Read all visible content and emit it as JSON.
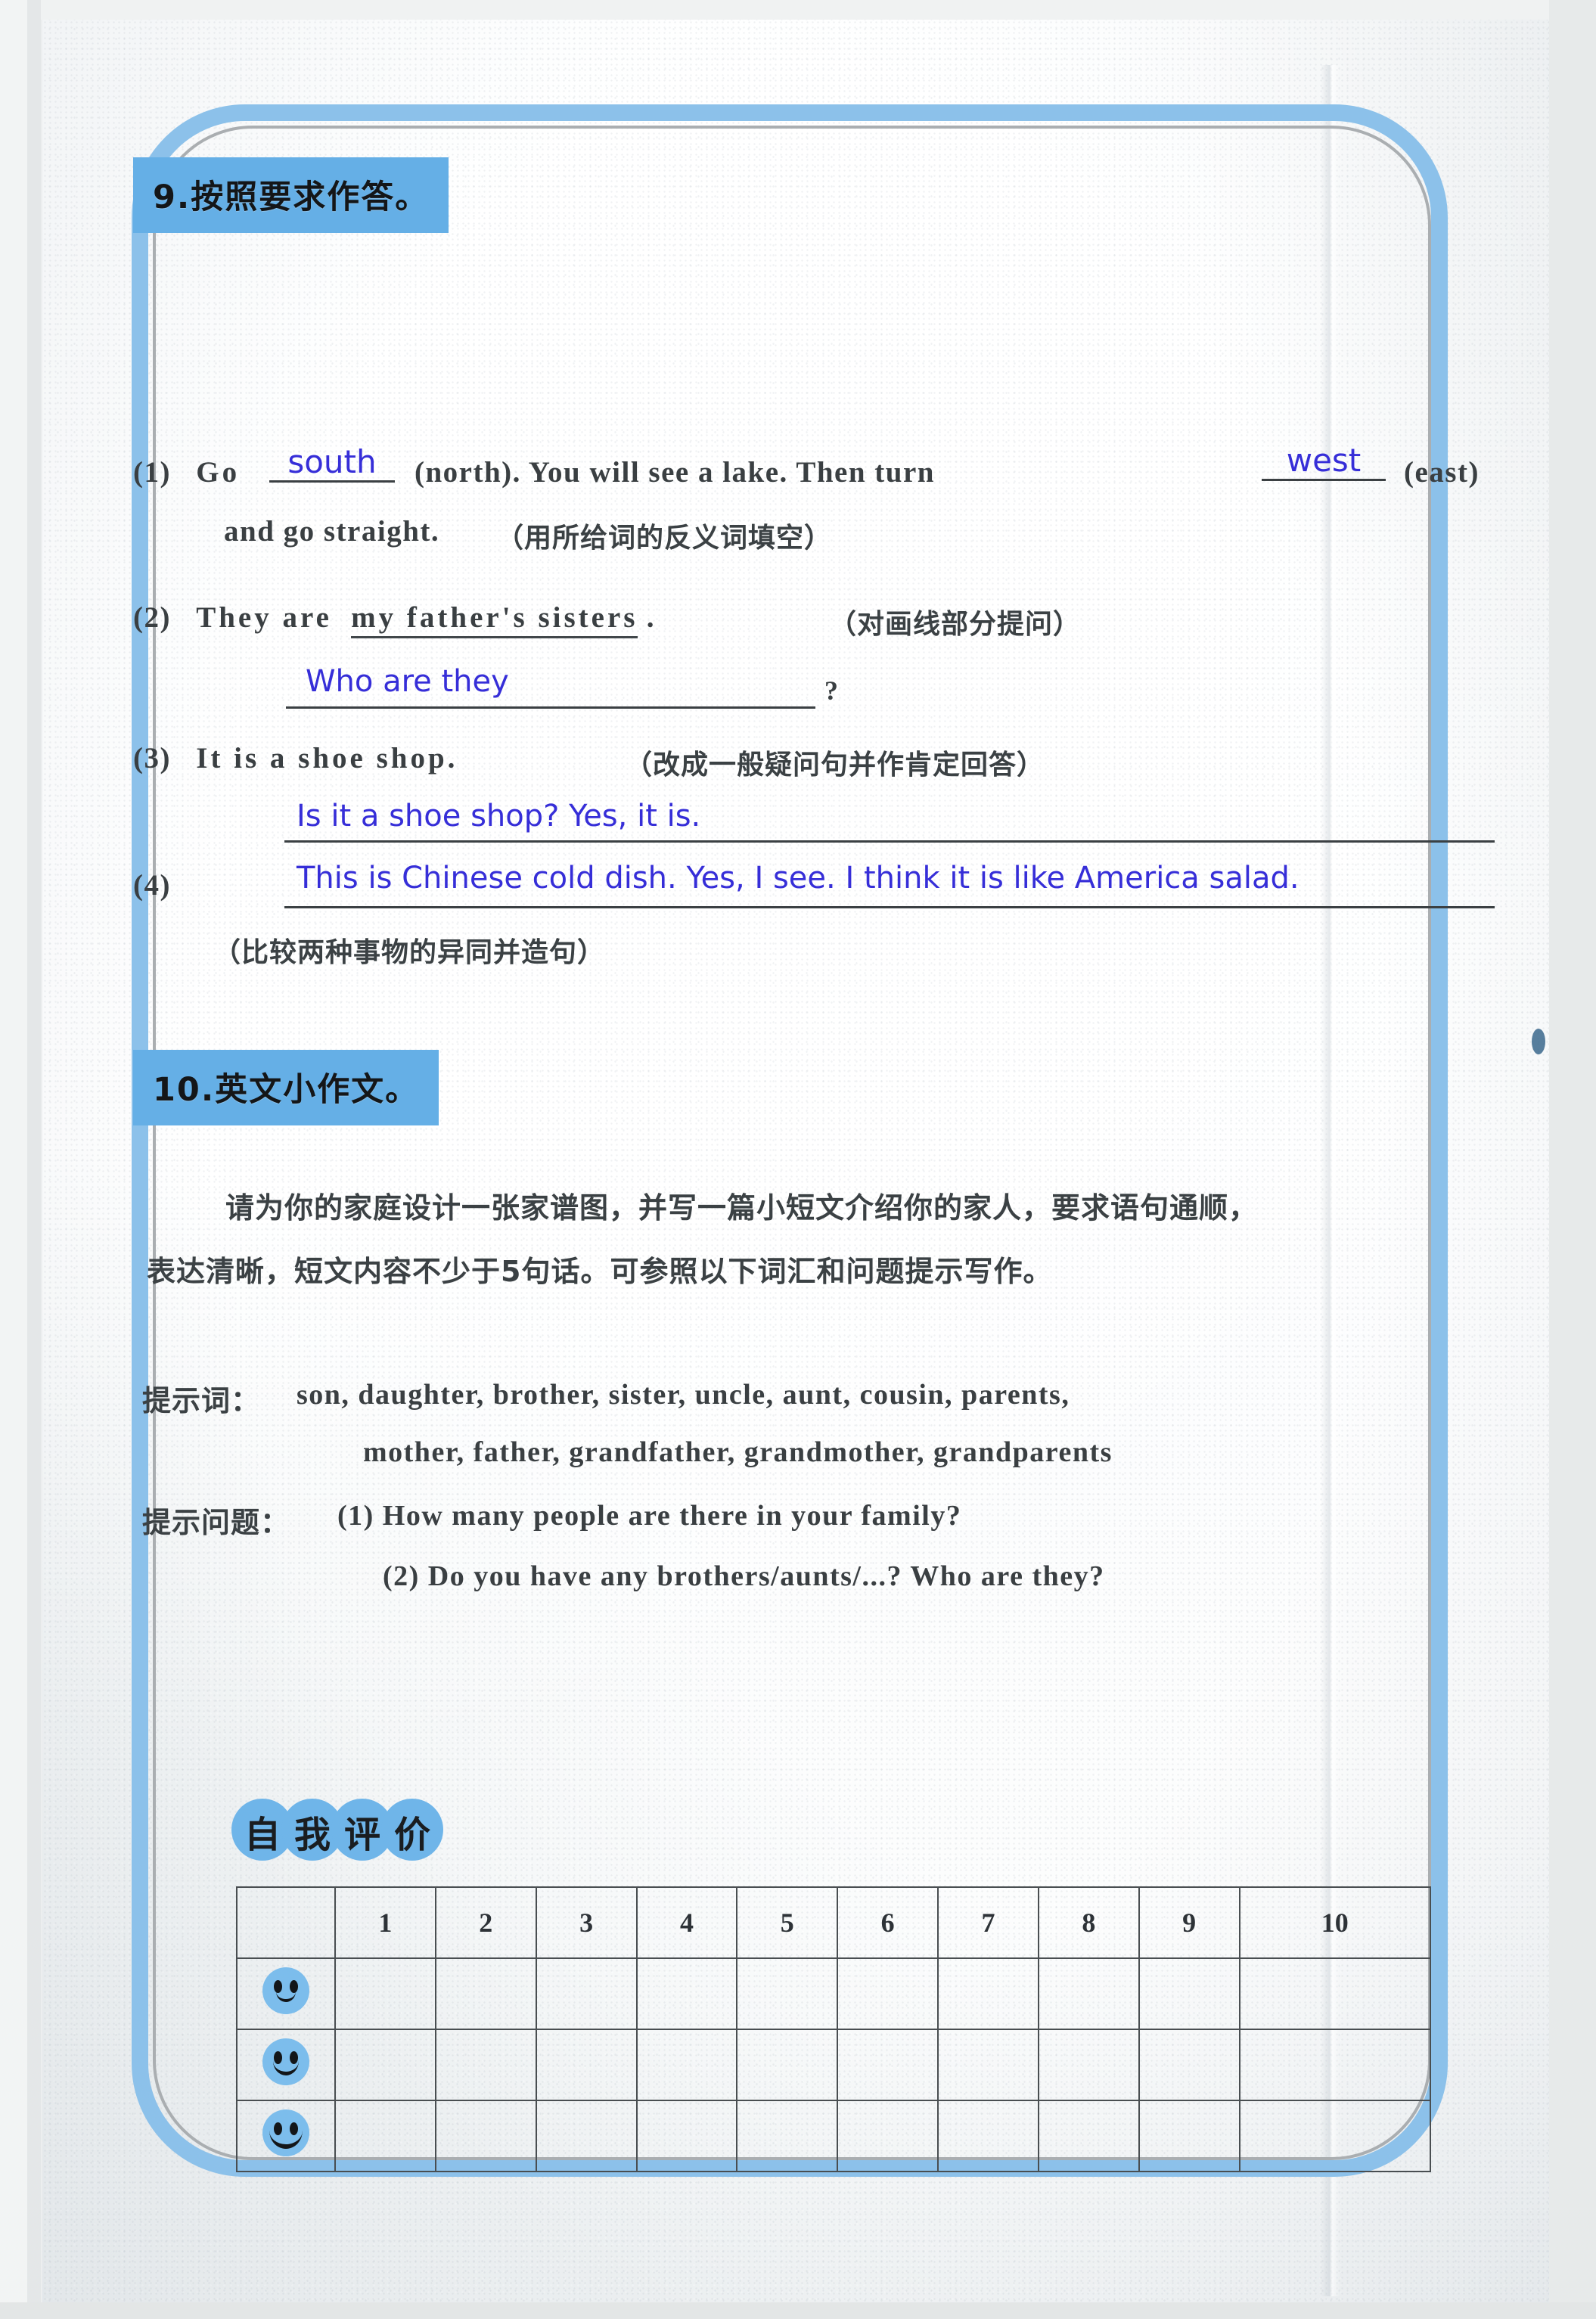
{
  "document": {
    "type": "scanned-workbook-page",
    "colors": {
      "badge_blue": "#66aee4",
      "frame_blue": "#8cc0e8",
      "handwriting_blue": "#3730d6",
      "print_black": "#3b4043",
      "smiley_blue": "#7cbcea"
    }
  },
  "section9": {
    "badge": "9.按照要求作答。",
    "q1": {
      "number": "(1)",
      "before_blank": "Go",
      "answer1": "south",
      "mid1": "(north). You will see a lake. Then turn",
      "answer2": "west",
      "mid2": "(east)",
      "line2_before": "and go straight.",
      "instruction": "（用所给词的反义词填空）"
    },
    "q2": {
      "number": "(2)",
      "stem_prefix": "They are",
      "stem_underlined": "my father's sisters",
      "stem_suffix": ".",
      "instruction": "（对画线部分提问）",
      "answer": "Who are they",
      "answer_suffix": "?"
    },
    "q3": {
      "number": "(3)",
      "stem": "It is a shoe shop.",
      "instruction": "（改成一般疑问句并作肯定回答）",
      "answer": "Is it a shoe shop? Yes, it is."
    },
    "q4": {
      "number": "(4)",
      "answer": "This is Chinese cold dish. Yes, I see. I think it is like America salad.",
      "instruction": "（比较两种事物的异同并造句）"
    }
  },
  "section10": {
    "badge": "10.英文小作文。",
    "paragraph_line1": "请为你的家庭设计一张家谱图，并写一篇小短文介绍你的家人，要求语句通顺，",
    "paragraph_line2": "表达清晰，短文内容不少于5句话。可参照以下词汇和问题提示写作。",
    "words_label": "提示词：",
    "words_line1": "son, daughter, brother, sister, uncle, aunt, cousin, parents,",
    "words_line2": "mother, father, grandfather, grandmother, grandparents",
    "questions_label": "提示问题：",
    "question1": "(1) How many people are there in your family?",
    "question2": "(2) Do you have any brothers/aunts/...? Who are they?"
  },
  "self_evaluation": {
    "title_chars": [
      "自",
      "我",
      "评",
      "价"
    ],
    "columns": [
      "1",
      "2",
      "3",
      "4",
      "5",
      "6",
      "7",
      "8",
      "9",
      "10"
    ],
    "rows": [
      {
        "icon": "smiley-face-slight",
        "cells": [
          "",
          "",
          "",
          "",
          "",
          "",
          "",
          "",
          "",
          ""
        ]
      },
      {
        "icon": "smiley-face-medium",
        "cells": [
          "",
          "",
          "",
          "",
          "",
          "",
          "",
          "",
          "",
          ""
        ]
      },
      {
        "icon": "smiley-face-wide",
        "cells": [
          "",
          "",
          "",
          "",
          "",
          "",
          "",
          "",
          "",
          ""
        ]
      }
    ]
  }
}
